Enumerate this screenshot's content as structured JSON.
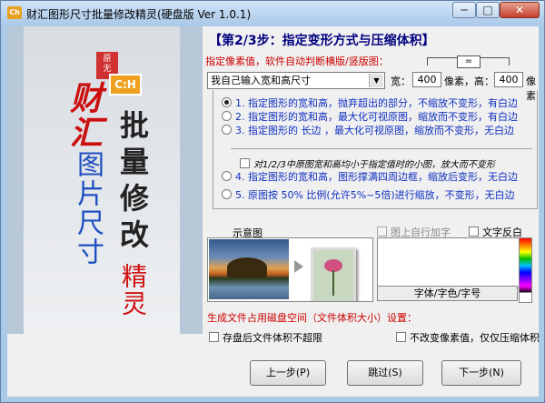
{
  "titlebar": {
    "icon_text": "Ch",
    "title": "财汇图形尺寸批量修改精灵(硬盘版 Ver 1.0.1)",
    "min": "─",
    "max": "□",
    "close": "✕"
  },
  "banner": {
    "logo_top": "原",
    "logo_mid": "无",
    "logo_bot": "图",
    "badge": "C:H",
    "caihui": "财汇",
    "tupian": "图片尺寸",
    "piliang": "批量修改",
    "jingling": "精灵"
  },
  "step": {
    "title": "【第2/3步：指定变形方式与压缩体积】",
    "subtitle": "指定像素值，软件自动判断横版/竖版图：",
    "equal_box": "="
  },
  "size": {
    "mode_selected": "我自己输入宽和高尺寸",
    "width_label": "宽：",
    "width_value": "400",
    "pixel_height_label": "像素，高：",
    "height_value": "400",
    "pixel_label": "像素"
  },
  "options": [
    {
      "label": "1. 指定图形的宽和高，抛弃超出的部分，不缩放不变形，有白边",
      "selected": true
    },
    {
      "label": "2. 指定图形的宽和高，最大化可视原图，缩放而不变形，有白边",
      "selected": false
    },
    {
      "label": "3. 指定图形的 长边 ，最大化可视原图，缩放而不变形，无白边",
      "selected": false
    },
    {
      "label": "4. 指定图形的宽和高，图形撑满四周边框，缩放后变形，无白边",
      "selected": false
    },
    {
      "label": "5. 原图按   50%   比例(允许5%~5倍)进行缩放，不变形，无白边",
      "selected": false
    }
  ],
  "small_image_note": "对1/2/3中原图宽和高均小于指定值时的小图，放大而不变形",
  "preview": {
    "label": "示意图"
  },
  "text_tools": {
    "add_text": "图上自行加字",
    "text_invert": "文字反白",
    "font_button": "字体/字色/字号"
  },
  "disk": {
    "label": "生成文件占用磁盘空间（文件体积大小）设置：",
    "no_larger": "存盘后文件体积不超限",
    "keep_pixels": "不改变像素值，仅仅压缩体积"
  },
  "buttons": {
    "prev": "上一步(P)",
    "skip": "跳过(S)",
    "next": "下一步(N)"
  }
}
